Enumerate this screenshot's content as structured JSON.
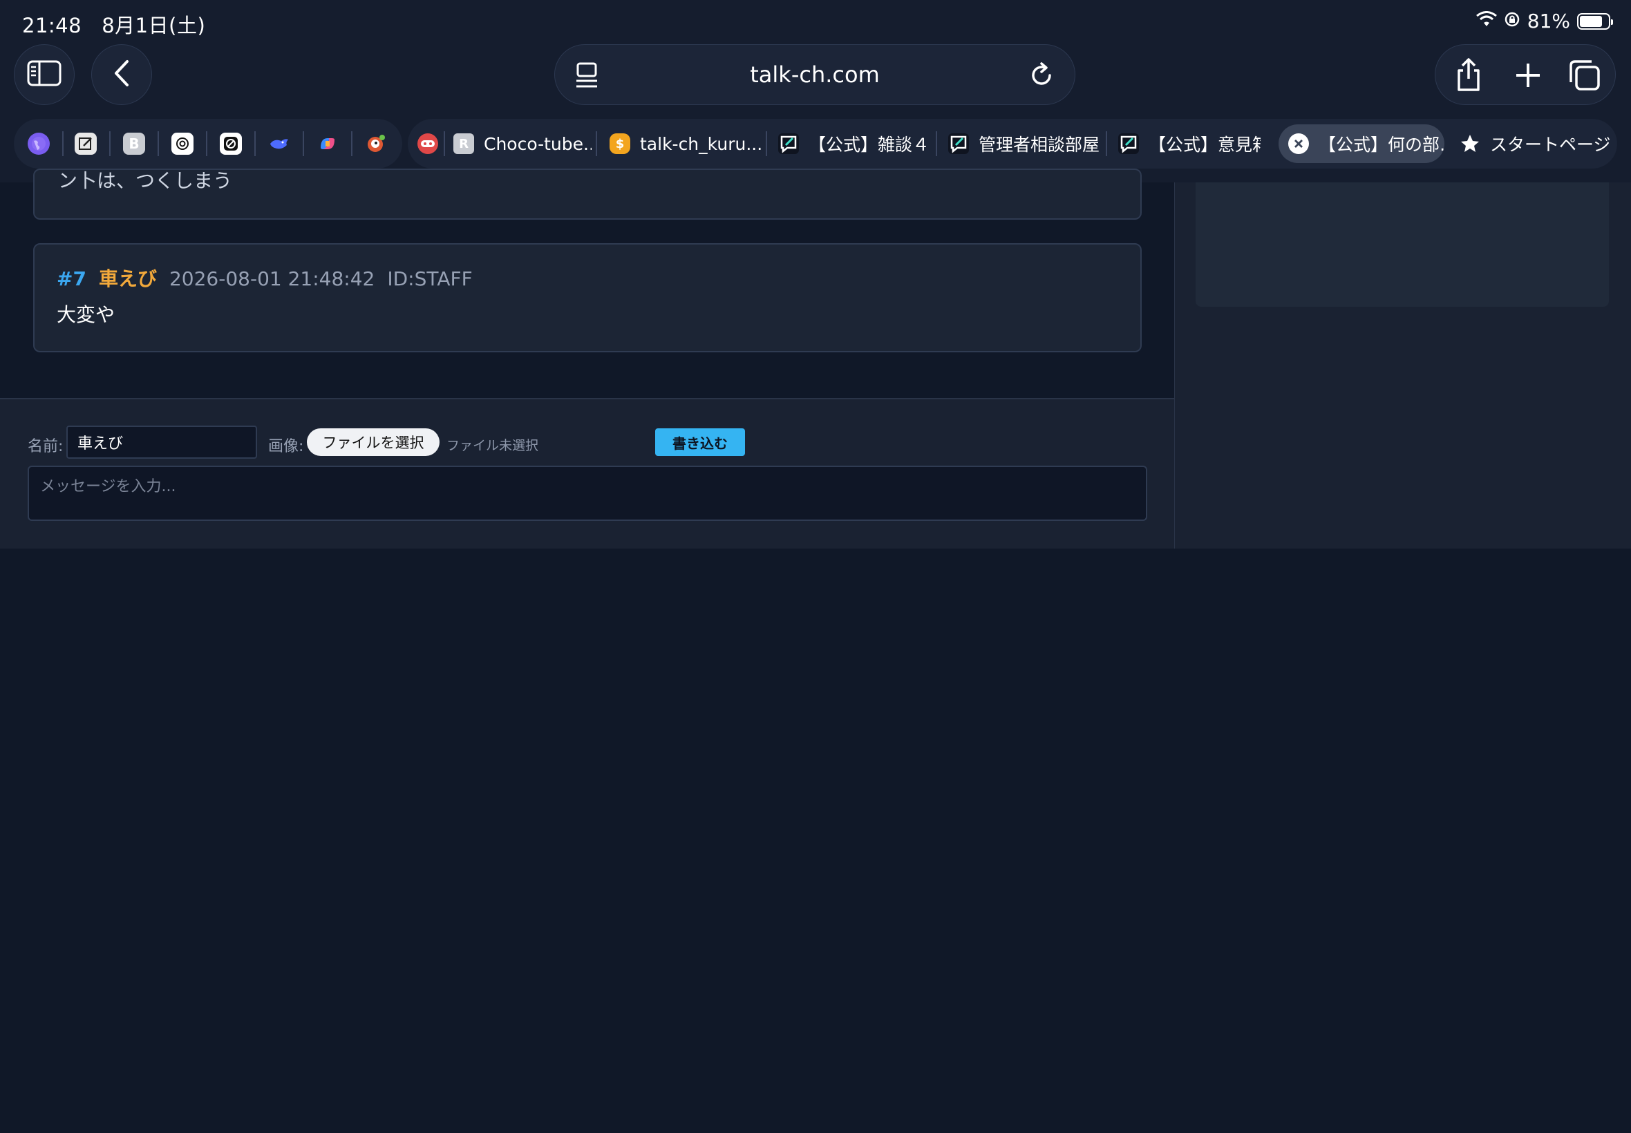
{
  "status_bar": {
    "time": "21:48",
    "date": "8月1日(土)",
    "battery": "81%",
    "battery_level": 0.81
  },
  "browser": {
    "url": "talk-ch.com",
    "favorites": [
      "globe-icon",
      "notes-icon",
      "b-icon",
      "openai-icon",
      "perplexity-icon",
      "deepseek-icon",
      "copilot-icon",
      "duckduckgo-icon"
    ],
    "tabs": [
      {
        "label": "Choco-tube..",
        "icon_letter": "R"
      },
      {
        "label": "talk-ch_kuru...",
        "icon_letter": "$"
      },
      {
        "label": "【公式】雑談４"
      },
      {
        "label": "管理者相談部屋"
      },
      {
        "label": "【公式】意見箱…"
      },
      {
        "label": "【公式】何の部…"
      },
      {
        "label": "スタートページ"
      }
    ]
  },
  "posts": [
    {
      "partial_text": "ン卜は、つくしまう"
    },
    {
      "num": "#7",
      "name": "車えび",
      "date": "2026-08-01 21:48:42",
      "id": "ID:STAFF",
      "body": "大変や"
    }
  ],
  "compose": {
    "name_label": "名前:",
    "name_value": "車えび",
    "image_label": "画像:",
    "file_button": "ファイルを選択",
    "file_status": "ファイル未選択",
    "submit_button": "書き込む",
    "message_placeholder": "メッセージを入力..."
  },
  "colors": {
    "background": "#101828",
    "accent": "#35b4f2",
    "post_number": "#3ba7f0",
    "post_name": "#f2a93b"
  }
}
